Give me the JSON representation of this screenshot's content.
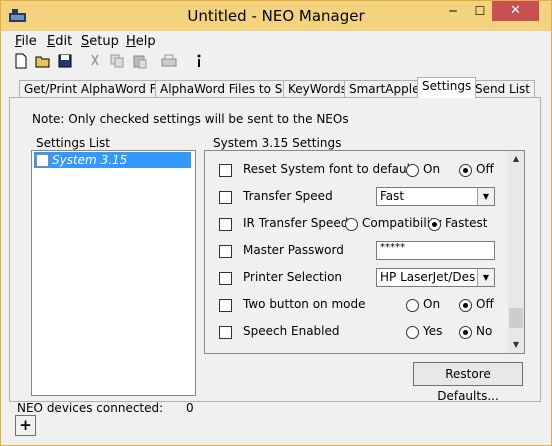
{
  "window": {
    "title": "Untitled - NEO Manager",
    "minimize_glyph": "─",
    "maximize_glyph": "☐",
    "close_glyph": "✕"
  },
  "menu": [
    {
      "label_ul": "F",
      "label_rest": "ile"
    },
    {
      "label_ul": "E",
      "label_rest": "dit"
    },
    {
      "label_ul": "S",
      "label_rest": "etup"
    },
    {
      "label_ul": "H",
      "label_rest": "elp"
    }
  ],
  "toolbar": {
    "icons": [
      "new-icon",
      "open-icon",
      "save-icon",
      "cut-icon",
      "copy-icon",
      "paste-icon",
      "print-icon",
      "info-icon"
    ]
  },
  "tabs": [
    {
      "label": "Get/Print AlphaWord Files"
    },
    {
      "label": "AlphaWord Files to Send"
    },
    {
      "label": "KeyWords"
    },
    {
      "label": "SmartApplets"
    },
    {
      "label": "Settings"
    },
    {
      "label": "Send List"
    }
  ],
  "panel": {
    "note": "Note: Only checked settings will be sent to the NEOs",
    "settings_list_label": "Settings List",
    "settings_list_item": "System 3.15",
    "settings_group_label": "System 3.15 Settings",
    "restore_button": "Restore Defaults..."
  },
  "settings": {
    "reset_font": {
      "label": "Reset System font to default",
      "opt1": "On",
      "opt2": "Off",
      "selected": "Off"
    },
    "transfer_speed": {
      "label": "Transfer Speed",
      "value": "Fast"
    },
    "ir_transfer": {
      "label": "IR Transfer Speed",
      "opt1": "Compatibility",
      "opt2": "Fastest",
      "selected": "Fastest"
    },
    "master_password": {
      "label": "Master Password",
      "value": "*****"
    },
    "printer": {
      "label": "Printer Selection",
      "value": "HP LaserJet/DeskJe"
    },
    "two_button": {
      "label": "Two button on mode",
      "opt1": "On",
      "opt2": "Off",
      "selected": "Off"
    },
    "speech": {
      "label": "Speech Enabled",
      "opt1": "Yes",
      "opt2": "No",
      "selected": "No"
    }
  },
  "status": {
    "label": "NEO devices connected:",
    "count": "0",
    "add_button": "+"
  }
}
